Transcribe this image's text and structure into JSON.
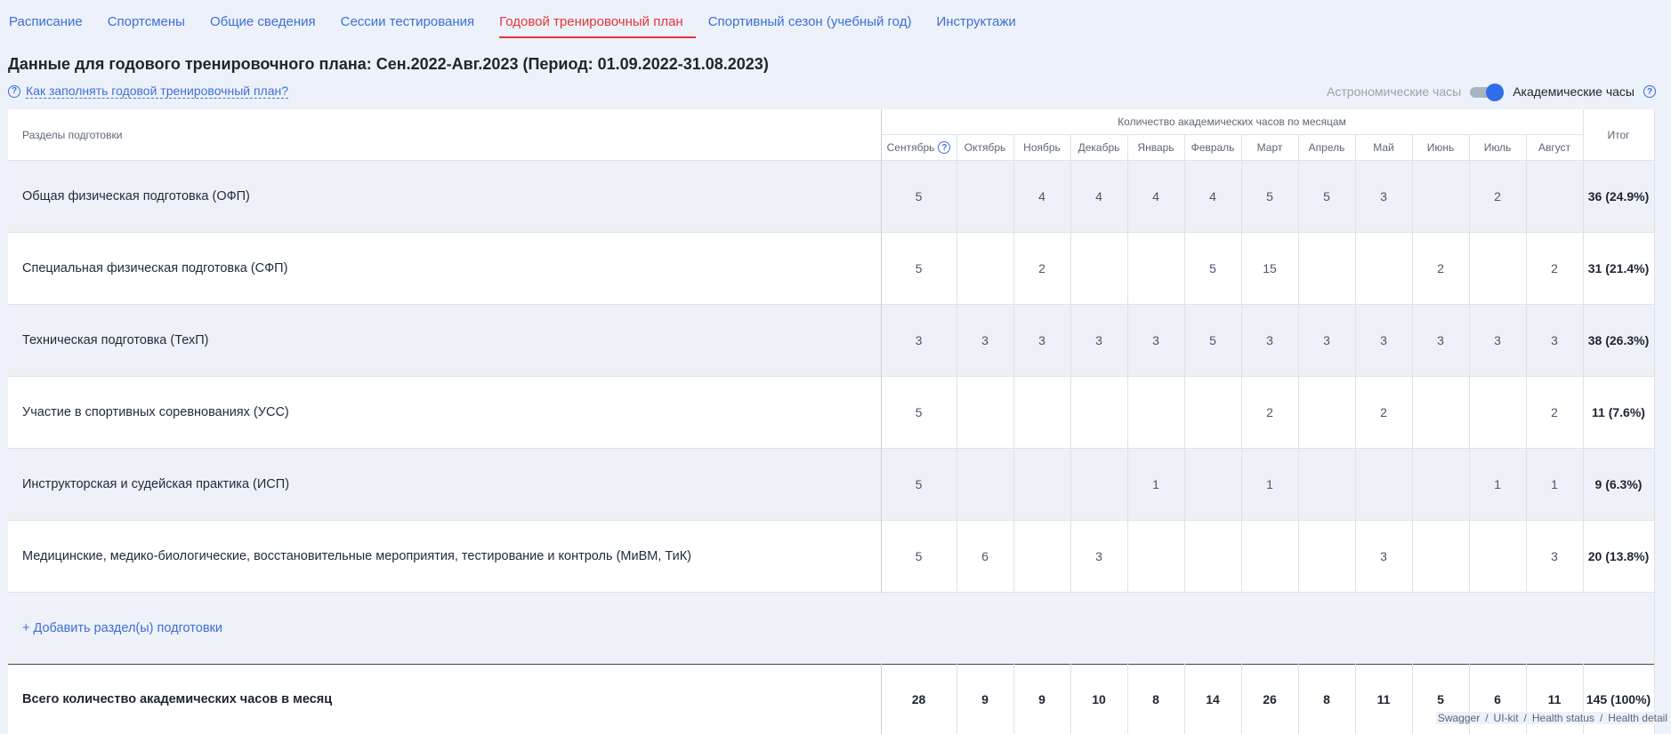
{
  "tabs": [
    {
      "label": "Расписание",
      "active": false
    },
    {
      "label": "Спортсмены",
      "active": false
    },
    {
      "label": "Общие сведения",
      "active": false
    },
    {
      "label": "Сессии тестирования",
      "active": false
    },
    {
      "label": "Годовой тренировочный план",
      "active": true
    },
    {
      "label": "Спортивный сезон (учебный год)",
      "active": false
    },
    {
      "label": "Инструктажи",
      "active": false
    }
  ],
  "page": {
    "title": "Данные для годового тренировочного плана: Сен.2022-Авг.2023 (Период: 01.09.2022-31.08.2023)",
    "help_link": "Как заполнять годовой тренировочный план?",
    "toggle_left": "Астрономические часы",
    "toggle_right": "Академические часы",
    "toggle_state": "academic"
  },
  "table": {
    "sections_header": "Разделы подготовки",
    "months_header": "Количество академических часов по месяцам",
    "total_header": "Итог",
    "months": [
      "Сентябрь",
      "Октябрь",
      "Ноябрь",
      "Декабрь",
      "Январь",
      "Февраль",
      "Март",
      "Апрель",
      "Май",
      "Июнь",
      "Июль",
      "Август"
    ],
    "rows": [
      {
        "name": "Общая физическая подготовка (ОФП)",
        "values": [
          "5",
          "",
          "4",
          "4",
          "4",
          "4",
          "5",
          "5",
          "3",
          "",
          "2",
          ""
        ],
        "total": "36 (24.9%)"
      },
      {
        "name": "Специальная физическая подготовка (СФП)",
        "values": [
          "5",
          "",
          "2",
          "",
          "",
          "5",
          "15",
          "",
          "",
          "2",
          "",
          "2"
        ],
        "total": "31 (21.4%)"
      },
      {
        "name": "Техническая подготовка (ТехП)",
        "values": [
          "3",
          "3",
          "3",
          "3",
          "3",
          "5",
          "3",
          "3",
          "3",
          "3",
          "3",
          "3"
        ],
        "total": "38 (26.3%)"
      },
      {
        "name": "Участие в спортивных соревнованиях (УСС)",
        "values": [
          "5",
          "",
          "",
          "",
          "",
          "",
          "2",
          "",
          "2",
          "",
          "",
          "2"
        ],
        "total": "11 (7.6%)"
      },
      {
        "name": "Инструкторская и судейская практика (ИСП)",
        "values": [
          "5",
          "",
          "",
          "",
          "1",
          "",
          "1",
          "",
          "",
          "",
          "1",
          "1"
        ],
        "total": "9 (6.3%)"
      },
      {
        "name": "Медицинские, медико-биологические, восстановительные мероприятия, тестирование и контроль (МиВМ, ТиК)",
        "values": [
          "5",
          "6",
          "",
          "3",
          "",
          "",
          "",
          "",
          "3",
          "",
          "",
          "3"
        ],
        "total": "20 (13.8%)"
      }
    ],
    "add_label": "+ Добавить раздел(ы) подготовки",
    "sum_row": {
      "name": "Всего количество академических часов в месяц",
      "values": [
        "28",
        "9",
        "9",
        "10",
        "8",
        "14",
        "26",
        "8",
        "11",
        "5",
        "6",
        "11"
      ],
      "total": "145 (100%)"
    }
  },
  "footer": {
    "links": [
      "Swagger",
      "UI-kit",
      "Health status",
      "Health detail"
    ]
  },
  "colors": {
    "accent": "#3d6fd6",
    "active_tab": "#e0363b",
    "toggle": "#2f6ee8"
  }
}
